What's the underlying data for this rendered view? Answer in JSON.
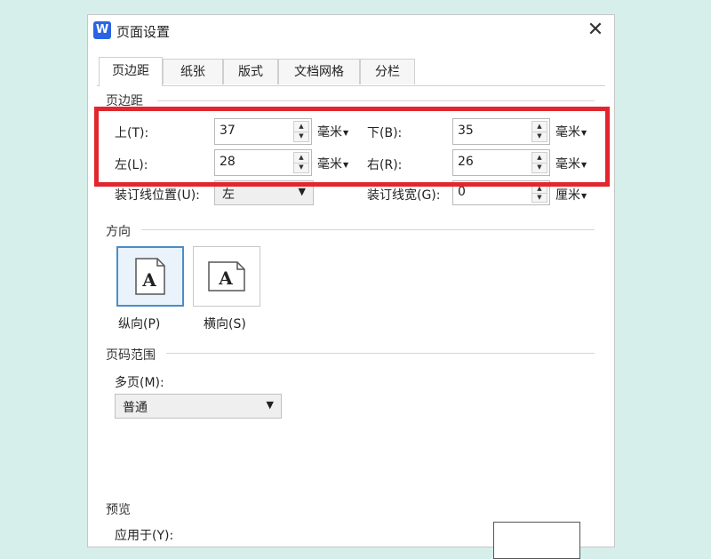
{
  "dialog": {
    "app_icon_letter": "W",
    "title": "页面设置",
    "close_glyph": "✕"
  },
  "tabs": [
    {
      "label": "页边距",
      "active": true
    },
    {
      "label": "纸张",
      "active": false
    },
    {
      "label": "版式",
      "active": false
    },
    {
      "label": "文档网格",
      "active": false
    },
    {
      "label": "分栏",
      "active": false
    }
  ],
  "margins": {
    "section_label": "页边距",
    "top": {
      "label": "上(T):",
      "value": "37",
      "unit": "毫米"
    },
    "bottom": {
      "label": "下(B):",
      "value": "35",
      "unit": "毫米"
    },
    "left": {
      "label": "左(L):",
      "value": "28",
      "unit": "毫米"
    },
    "right": {
      "label": "右(R):",
      "value": "26",
      "unit": "毫米"
    },
    "gutter_position": {
      "label": "装订线位置(U):",
      "value": "左"
    },
    "gutter_width": {
      "label": "装订线宽(G):",
      "value": "0",
      "unit": "厘米"
    }
  },
  "orientation": {
    "section_label": "方向",
    "portrait": {
      "label": "纵向(P)",
      "glyph": "A",
      "selected": true
    },
    "landscape": {
      "label": "横向(S)",
      "glyph": "A",
      "selected": false
    }
  },
  "page_range": {
    "section_label": "页码范围",
    "multiple_pages_label": "多页(M):",
    "multiple_pages_value": "普通"
  },
  "preview": {
    "section_label": "预览",
    "apply_to_label": "应用于(Y):"
  },
  "colors": {
    "highlight": "#e2262d",
    "accent": "#4a8ec8",
    "app_icon": "#2b63e3",
    "background": "#d6efeb"
  }
}
